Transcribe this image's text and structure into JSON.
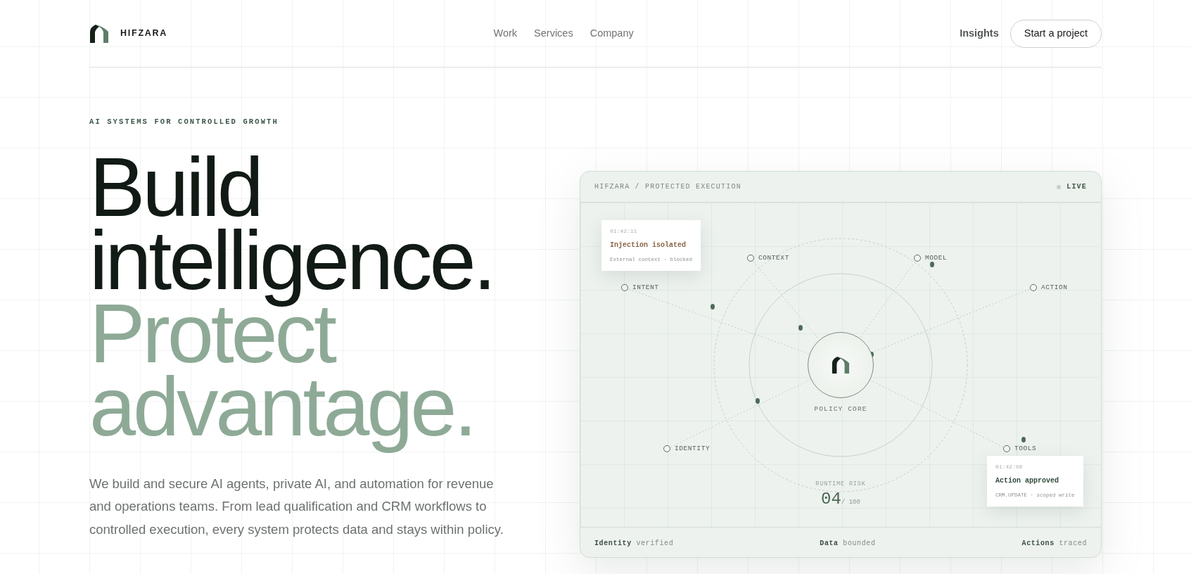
{
  "brand": {
    "name": "HIFZARA"
  },
  "nav": {
    "links": [
      {
        "label": "Work"
      },
      {
        "label": "Services"
      },
      {
        "label": "Company"
      }
    ],
    "secondary_link": "Insights",
    "cta": "Start a project"
  },
  "hero": {
    "eyebrow": "AI SYSTEMS FOR CONTROLLED GROWTH",
    "headline": [
      {
        "text": "Build",
        "kind": "primary"
      },
      {
        "text": "intelligence.",
        "kind": "primary"
      },
      {
        "text": "Protect",
        "kind": "accent"
      },
      {
        "text": "advantage.",
        "kind": "accent"
      }
    ],
    "body": "We build and secure AI agents, private AI, and automation for revenue and operations teams. From lead qualification and CRM workflows to controlled execution, every system protects data and stays within policy."
  },
  "panel": {
    "title": "HIFZARA / PROTECTED EXECUTION",
    "status": "LIVE",
    "nodes": [
      {
        "label": "CONTEXT"
      },
      {
        "label": "MODEL"
      },
      {
        "label": "INTENT"
      },
      {
        "label": "ACTION"
      },
      {
        "label": "IDENTITY"
      },
      {
        "label": "TOOLS"
      }
    ],
    "core_label": "POLICY CORE",
    "risk": {
      "label": "RUNTIME RISK",
      "value": "04",
      "max": "/ 100"
    },
    "events": [
      {
        "time": "01:42:11",
        "title": "Injection isolated",
        "detail": "External context · blocked",
        "kind": "blocked"
      },
      {
        "time": "01:42:08",
        "title": "Action approved",
        "detail": "CRM.UPDATE · scoped write",
        "kind": "approved"
      }
    ],
    "footer": [
      {
        "term": "Identity",
        "value": "verified"
      },
      {
        "term": "Data",
        "value": "bounded"
      },
      {
        "term": "Actions",
        "value": "traced"
      }
    ]
  }
}
